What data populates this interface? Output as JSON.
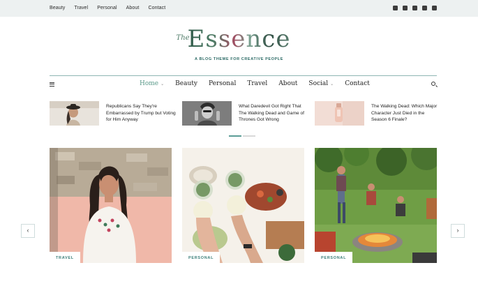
{
  "top_nav": {
    "items": [
      "Beauty",
      "Travel",
      "Personal",
      "About",
      "Contact"
    ],
    "social_icons": [
      "twitter-icon",
      "facebook-icon",
      "instagram-icon",
      "vimeo-icon",
      "pinterest-icon"
    ]
  },
  "logo": {
    "the": "The",
    "name": "Essence",
    "tagline": "A BLOG THEME FOR CREATIVE PEOPLE"
  },
  "main_nav": {
    "items": [
      {
        "label": "Home",
        "has_dropdown": true,
        "active": true
      },
      {
        "label": "Beauty",
        "has_dropdown": false
      },
      {
        "label": "Personal",
        "has_dropdown": false
      },
      {
        "label": "Travel",
        "has_dropdown": false
      },
      {
        "label": "About",
        "has_dropdown": false
      },
      {
        "label": "Social",
        "has_dropdown": true
      },
      {
        "label": "Contact",
        "has_dropdown": false
      }
    ],
    "caret": "⌄"
  },
  "featured": [
    {
      "title": "Republicans Say They're Embarrassed by Trump but Voting for Him Anyway"
    },
    {
      "title": "What Daredevil Got Right That The Walking Dead and Game of Thrones Got Wrong"
    },
    {
      "title": "The Walking Dead: Which Major Character Just Died in the Season 6 Finale?"
    }
  ],
  "slider": {
    "current_index": 0,
    "slide_count": 2
  },
  "cards": [
    {
      "tag": "TRAVEL"
    },
    {
      "tag": "PERSONAL"
    },
    {
      "tag": "PERSONAL"
    }
  ],
  "arrows": {
    "prev": "‹",
    "next": "›"
  },
  "colors": {
    "accent": "#5b9d97",
    "topbar_bg": "#edf1f1",
    "tag_text": "#3b7f79"
  }
}
